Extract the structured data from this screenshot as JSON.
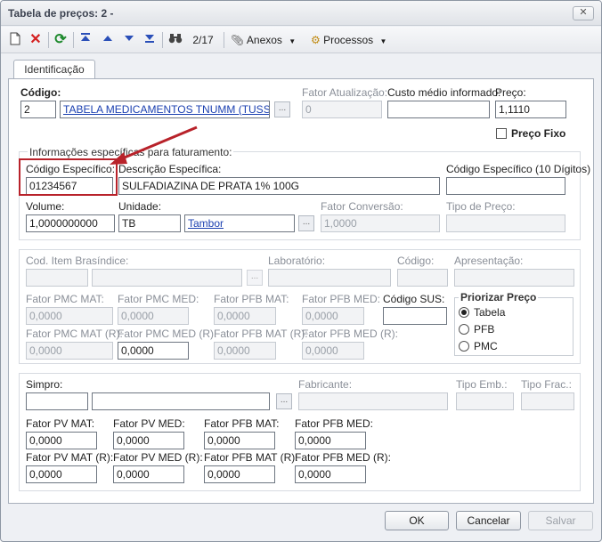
{
  "window": {
    "title": "Tabela de preços: 2 -",
    "close_label": "✕"
  },
  "toolbar": {
    "record_position": "2/17",
    "attachments_label": "Anexos",
    "processes_label": "Processos"
  },
  "tabs": [
    {
      "label": "Identificação"
    }
  ],
  "header": {
    "codigo_label": "Código:",
    "codigo_value": "2",
    "table_link": "TABELA MEDICAMENTOS TNUMM (TUSS)",
    "fator_atualizacao_label": "Fator Atualização:",
    "fator_atualizacao_value": "0",
    "custo_medio_label": "Custo médio informado:",
    "custo_medio_value": "",
    "preco_label": "Preço:",
    "preco_value": "1,1110",
    "preco_fixo_label": "Preço Fixo"
  },
  "faturamento": {
    "group_label": "Informações específicas para faturamento:",
    "codigo_especifico_label": "Código Específico:",
    "codigo_especifico_value": "01234567",
    "descricao_especifica_label": "Descrição Específica:",
    "descricao_especifica_value": "SULFADIAZINA DE PRATA 1% 100G",
    "codigo_10_label": "Código Específico (10 Dígitos)",
    "codigo_10_value": "",
    "volume_label": "Volume:",
    "volume_value": "1,0000000000",
    "unidade_label": "Unidade:",
    "unidade_value": "TB",
    "unidade_link": "Tambor",
    "fator_conversao_label": "Fator Conversão:",
    "fator_conversao_value": "1,0000",
    "tipo_preco_label": "Tipo de Preço:",
    "tipo_preco_value": ""
  },
  "brasindice": {
    "cod_item_label": "Cod. Item Brasíndice:",
    "laboratorio_label": "Laboratório:",
    "codigo_label": "Código:",
    "apresentacao_label": "Apresentação:",
    "fator_pmc_mat_label": "Fator PMC MAT:",
    "fator_pmc_med_label": "Fator PMC MED:",
    "fator_pfb_mat_label": "Fator PFB MAT:",
    "fator_pfb_med_label": "Fator PFB MED:",
    "codigo_sus_label": "Código SUS:",
    "fator_pmc_mat_r_label": "Fator PMC MAT (R):",
    "fator_pmc_med_r_label": "Fator PMC MED (R):",
    "fator_pfb_mat_r_label": "Fator PFB MAT (R):",
    "fator_pfb_med_r_label": "Fator PFB MED (R):",
    "zero_value": "0,0000"
  },
  "priorizar": {
    "title": "Priorizar Preço",
    "options": [
      "Tabela",
      "PFB",
      "PMC"
    ],
    "selected": "Tabela"
  },
  "simpro": {
    "simpro_label": "Simpro:",
    "fabricante_label": "Fabricante:",
    "tipo_emb_label": "Tipo Emb.:",
    "tipo_frac_label": "Tipo Frac.:",
    "fator_pv_mat_label": "Fator PV MAT:",
    "fator_pv_med_label": "Fator PV MED:",
    "fator_pfb_mat_label": "Fator PFB MAT:",
    "fator_pfb_med_label": "Fator PFB MED:",
    "fator_pv_mat_r_label": "Fator PV MAT (R):",
    "fator_pv_med_r_label": "Fator PV MED (R):",
    "fator_pfb_mat_r_label": "Fator PFB MAT (R):",
    "fator_pfb_med_r_label": "Fator PFB MED (R):",
    "zero_value": "0,0000"
  },
  "footer": {
    "ok_label": "OK",
    "cancel_label": "Cancelar",
    "save_label": "Salvar"
  },
  "colors": {
    "highlight": "#b8222a",
    "link": "#1a3fb0",
    "accent_delete": "#d42020",
    "accent_refresh": "#1f8a2e"
  }
}
